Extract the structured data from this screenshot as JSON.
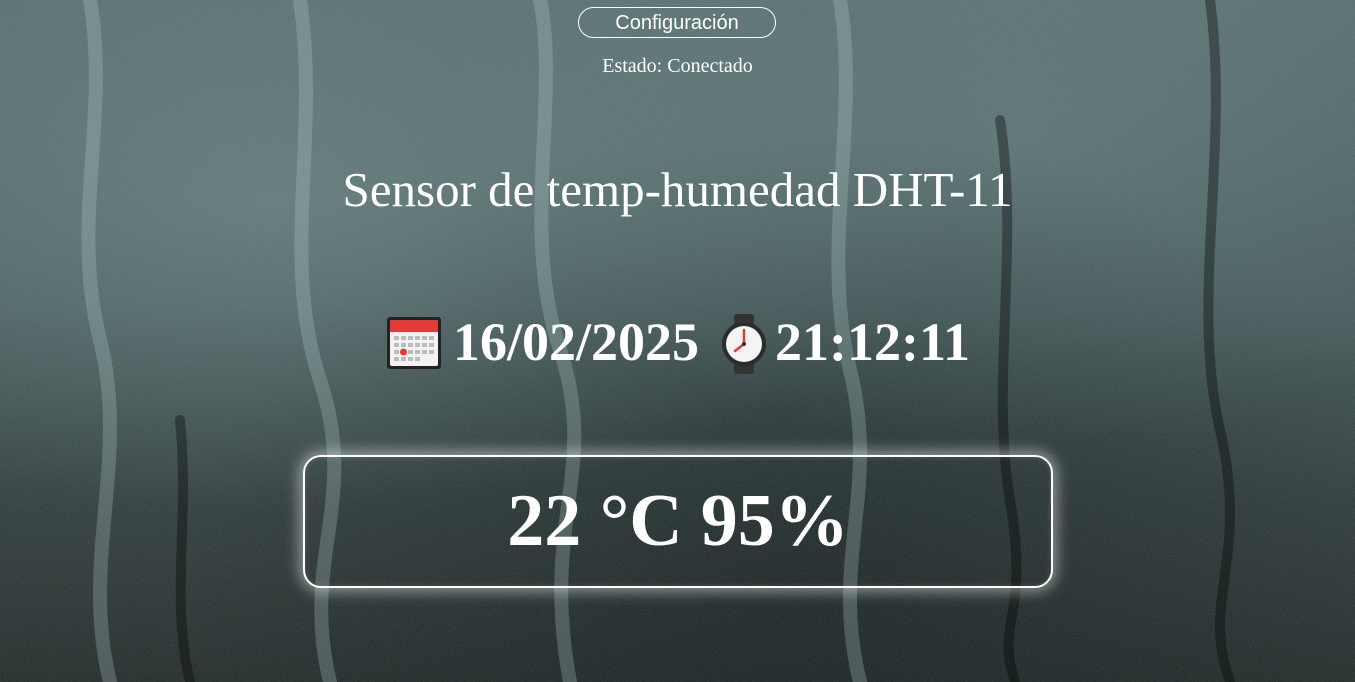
{
  "header": {
    "config_button_label": "Configuración",
    "status_text": "Estado: Conectado"
  },
  "title": "Sensor de temp-humedad DHT-11",
  "datetime": {
    "date": "16/02/2025",
    "time": "21:12:11",
    "date_icon": "calendar-icon",
    "time_icon": "watch-icon"
  },
  "reading": {
    "temperature": "22 °C",
    "humidity": "95%"
  },
  "colors": {
    "text": "#ffffff",
    "background": "#3e5152",
    "calendar_red": "#e53935"
  }
}
